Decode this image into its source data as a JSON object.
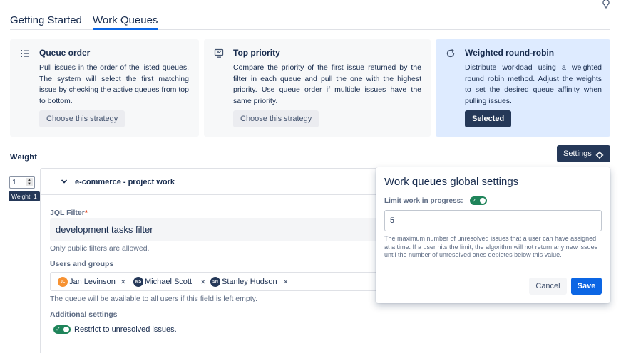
{
  "tabs": [
    {
      "label": "Getting Started"
    },
    {
      "label": "Work Queues"
    }
  ],
  "strategies": [
    {
      "icon": "list-order-icon",
      "title": "Queue order",
      "description": "Pull issues in the order of the listed queues. The system will select the first matching issue by checking the active queues from top to bottom.",
      "button": "Choose this strategy",
      "selected": false
    },
    {
      "icon": "monitor-icon",
      "title": "Top priority",
      "description": "Compare the priority of the first issue returned by the filter in each queue and pull the one with the highest priority. Use queue order if multiple issues have the same priority.",
      "button": "Choose this strategy",
      "selected": false
    },
    {
      "icon": "refresh-icon",
      "title": "Weighted round-robin",
      "description": "Distribute workload using a weighted round robin method. Adjust the weights to set the desired queue affinity when pulling issues.",
      "button": "Selected",
      "selected": true
    }
  ],
  "weight": {
    "label": "Weight",
    "value": "1",
    "tooltip": "Weight: 1"
  },
  "settings_button": "Settings",
  "queue": {
    "title": "e-commerce - project work",
    "jql_label": "JQL Filter",
    "required_mark": "*",
    "jql_value": "development tasks filter",
    "jql_help": "Only public filters are allowed.",
    "users_label": "Users and groups",
    "users": [
      {
        "initials": "JL",
        "name": "Jan Levinson",
        "color": "#f79232"
      },
      {
        "initials": "MS",
        "name": "Michael Scott",
        "color": "#253858"
      },
      {
        "initials": "SH",
        "name": "Stanley Hudson",
        "color": "#253858"
      }
    ],
    "users_help": "The queue will be available to all users if this field is left empty.",
    "additional_label": "Additional settings",
    "restrict_label": "Restrict to unresolved issues."
  },
  "global_settings": {
    "title": "Work queues global settings",
    "limit_label": "Limit work in progress:",
    "limit_value": "5",
    "description": "The maximum number of unresolved issues that a user can have assigned at a time. If a user hits the limit, the algorithm will not return any new issues until the number of unresolved ones depletes below this value.",
    "cancel": "Cancel",
    "save": "Save"
  },
  "colors": {
    "accent": "#0c66e4",
    "dark_button": "#253858",
    "toggle_on": "#1f845a",
    "selected_card": "#deebff"
  }
}
